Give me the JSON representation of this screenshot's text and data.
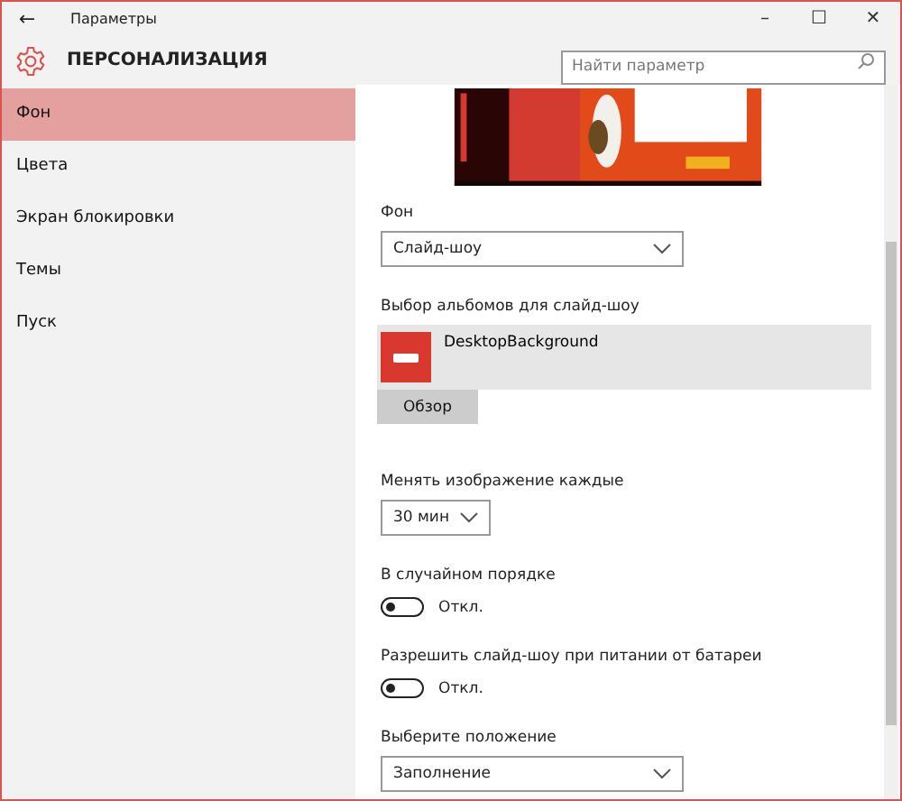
{
  "window": {
    "title": "Параметры",
    "back": "←",
    "controls": [
      "–",
      "☐",
      "✕"
    ]
  },
  "header": {
    "title": "ПЕРСОНАЛИЗАЦИЯ",
    "search": {
      "placeholder": "Найти параметр"
    }
  },
  "sidebar": {
    "items": [
      {
        "label": "Фон",
        "selected": true
      },
      {
        "label": "Цвета",
        "selected": false
      },
      {
        "label": "Экран блокировки",
        "selected": false
      },
      {
        "label": "Темы",
        "selected": false
      },
      {
        "label": "Пуск",
        "selected": false
      }
    ]
  },
  "settings": [
    {
      "kind": "dropdown",
      "label": "Фон",
      "value": "Слайд-шоу",
      "wide": true
    },
    {
      "kind": "album",
      "label": "Выбор альбомов для слайд-шоу",
      "album": "DesktopBackground",
      "button": "Обзор"
    },
    {
      "kind": "dropdown",
      "label": "Менять изображение каждые",
      "value": "30 мин",
      "wide": false
    },
    {
      "kind": "toggle",
      "label": "В случайном порядке",
      "on": false,
      "state": "Откл."
    },
    {
      "kind": "toggle",
      "label": "Разрешить слайд-шоу при питании от батареи",
      "on": false,
      "state": "Откл."
    },
    {
      "kind": "dropdown",
      "label": "Выберите положение",
      "value": "Заполнение",
      "wide": true
    }
  ]
}
